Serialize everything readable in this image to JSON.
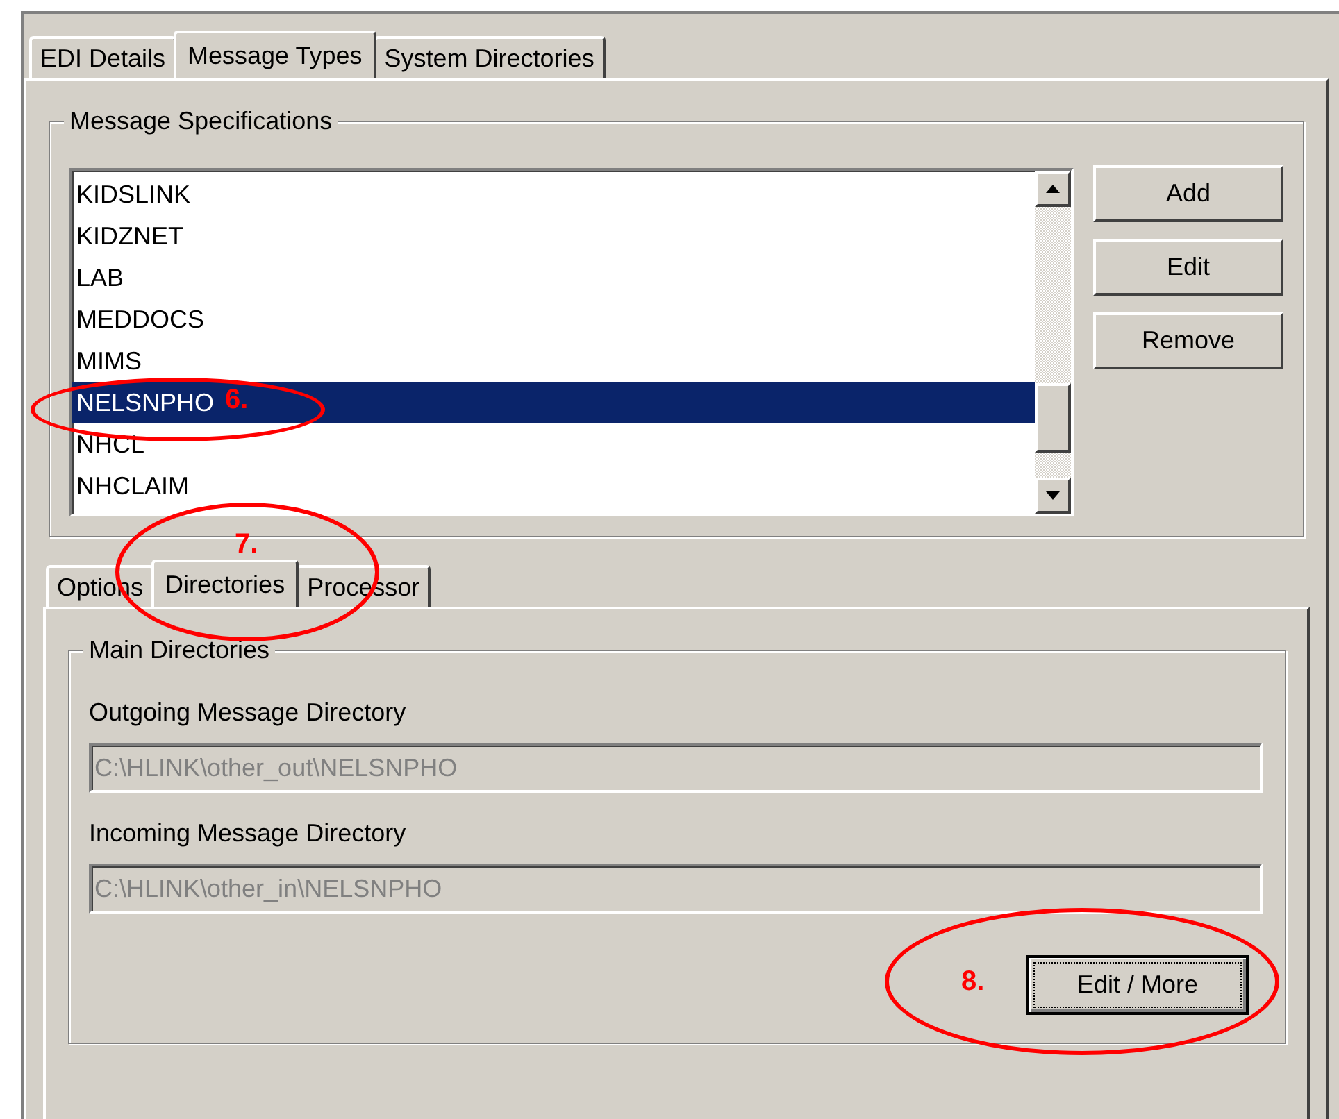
{
  "tabs": [
    {
      "label": "EDI Details",
      "selected": false
    },
    {
      "label": "Message Types",
      "selected": true
    },
    {
      "label": "System Directories",
      "selected": false
    }
  ],
  "message_specifications": {
    "title": "Message Specifications",
    "items": [
      {
        "label": "KIDSLINK",
        "selected": false
      },
      {
        "label": "KIDZNET",
        "selected": false
      },
      {
        "label": "LAB",
        "selected": false
      },
      {
        "label": "MEDDOCS",
        "selected": false
      },
      {
        "label": "MIMS",
        "selected": false
      },
      {
        "label": "NELSNPHO",
        "selected": true
      },
      {
        "label": "NHCL",
        "selected": false
      },
      {
        "label": "NHCLAIM",
        "selected": false
      }
    ],
    "buttons": [
      "Add",
      "Edit",
      "Remove"
    ]
  },
  "sub_tabs": [
    {
      "label": "Options",
      "selected": false
    },
    {
      "label": "Directories",
      "selected": true
    },
    {
      "label": "Processor",
      "selected": false
    }
  ],
  "main_directories": {
    "title": "Main Directories",
    "fields": [
      {
        "label": "Outgoing Message Directory",
        "value": "C:\\HLINK\\other_out\\NELSNPHO",
        "disabled": true
      },
      {
        "label": "Incoming Message Directory",
        "value": "C:\\HLINK\\other_in\\NELSNPHO",
        "disabled": true
      }
    ],
    "button": {
      "label": "Edit / More",
      "focused": true
    }
  },
  "annotations": [
    {
      "label": "6."
    },
    {
      "label": "7."
    },
    {
      "label": "8."
    }
  ]
}
